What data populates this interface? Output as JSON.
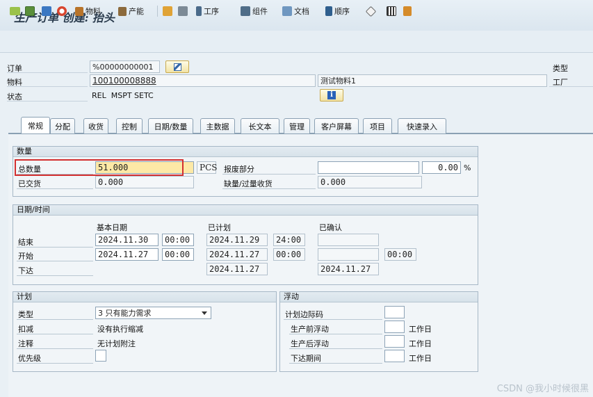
{
  "title": "生产订单 创建: 抬头",
  "toolbar": {
    "material": "物料",
    "capacity": "产能",
    "operations": "工序",
    "components": "组件",
    "documents": "文档",
    "sequences": "顺序"
  },
  "header": {
    "order_label": "订单",
    "order_value": "%00000000001",
    "material_label": "物料",
    "material_value": "100100008888",
    "material_desc": "测试物料1",
    "status_label": "状态",
    "status_value": "REL  MSPT SETC",
    "type_label": "类型",
    "plant_label": "工厂"
  },
  "tabs": [
    "常规",
    "分配",
    "收货",
    "控制",
    "日期/数量",
    "主数据",
    "长文本",
    "管理",
    "客户屏幕",
    "项目",
    "快速录入"
  ],
  "quantity": {
    "section": "数量",
    "total_label": "总数量",
    "total_value": "51.000",
    "unit": "PCS",
    "scrap_label": "报废部分",
    "scrap_value": "",
    "scrap_pct": "0.00",
    "pct_sign": "%",
    "delivered_label": "已交货",
    "delivered_value": "0.000",
    "shortage_label": "缺量/过量收货",
    "shortage_value": "0.000"
  },
  "dates": {
    "section": "日期/时间",
    "basic_label": "基本日期",
    "scheduled_label": "已计划",
    "confirmed_label": "已确认",
    "end_label": "结束",
    "start_label": "开始",
    "release_label": "下达",
    "end_basic": "2024.11.30",
    "end_basic_time": "00:00",
    "end_sched": "2024.11.29",
    "end_sched_time": "24:00",
    "start_basic": "2024.11.27",
    "start_basic_time": "00:00",
    "start_sched": "2024.11.27",
    "start_sched_time": "00:00",
    "start_conf_time": "00:00",
    "release_sched": "2024.11.27",
    "release_conf": "2024.11.27"
  },
  "planning": {
    "section": "计划",
    "type_label": "类型",
    "type_value": "3 只有能力需求",
    "reduction_label": "扣减",
    "reduction_value": "没有执行缩减",
    "note_label": "注释",
    "note_value": "无计划附注",
    "priority_label": "优先级"
  },
  "float": {
    "section": "浮动",
    "sm_label": "计划边际码",
    "before_label": "生产前浮动",
    "after_label": "生产后浮动",
    "release_label": "下达期间",
    "unit": "工作日"
  },
  "watermark": "CSDN @我小时候很黑",
  "colors": {
    "highlight_box": "#d32f2f",
    "focus_field": "#fde9a6"
  }
}
